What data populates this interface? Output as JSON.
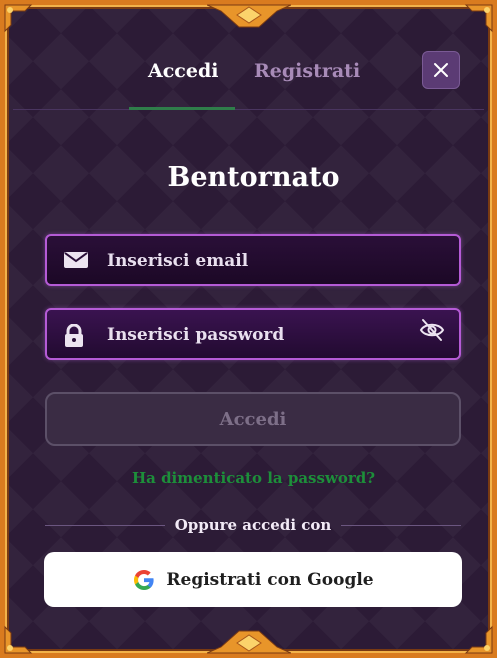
{
  "tabs": [
    {
      "label": "Accedi",
      "active": true
    },
    {
      "label": "Registrati",
      "active": false
    }
  ],
  "close_icon": "close-icon",
  "title": "Bentornato",
  "email": {
    "placeholder": "Inserisci email",
    "value": "",
    "icon": "envelope-icon"
  },
  "password": {
    "placeholder": "Inserisci password",
    "value": "",
    "icon": "lock-icon",
    "toggle_icon": "eye-off-icon"
  },
  "submit_label": "Accedi",
  "forgot_label": "Ha dimenticato la password?",
  "divider_label": "Oppure accedi con",
  "google_label": "Registrati con Google",
  "colors": {
    "background": "#2c1b36",
    "frame": "#d97b1f",
    "field_border": "#b55bd6",
    "forgot_link": "#1d8f3a",
    "active_tab_underline": "#2f7d4a"
  }
}
